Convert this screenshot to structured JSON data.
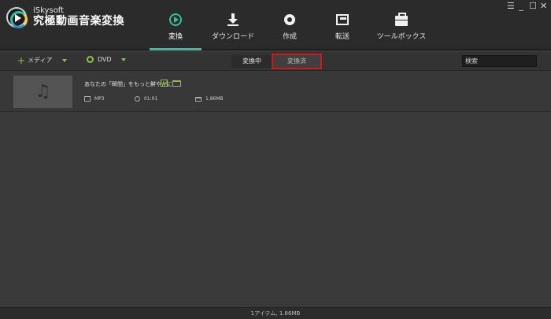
{
  "app": {
    "brand_sub": "iSkysoft",
    "brand_title": "究極動画音楽変換"
  },
  "nav": [
    {
      "label": "変換",
      "icon": "convert-icon",
      "active": true
    },
    {
      "label": "ダウンロード",
      "icon": "download-icon",
      "active": false
    },
    {
      "label": "作成",
      "icon": "burn-icon",
      "active": false
    },
    {
      "label": "転送",
      "icon": "transfer-icon",
      "active": false
    },
    {
      "label": "ツールボックス",
      "icon": "toolbox-icon",
      "active": false
    }
  ],
  "window_controls": {
    "menu": "☰",
    "minimize": "_",
    "maximize": "☐",
    "close": "✕"
  },
  "toolbar": {
    "add_media_label": "メディア",
    "dvd_label": "DVD",
    "tab_converting": "変換中",
    "tab_converted": "変換済",
    "search_placeholder": "検索"
  },
  "files": [
    {
      "name": "あなたの「瞬間」をもっと鮮やかに",
      "format": "MP3",
      "duration": "01:01",
      "size": "1.86MB"
    }
  ],
  "status": {
    "summary": "1アイテム, 1.86MB"
  },
  "colors": {
    "accent": "#2cc3a5",
    "green": "#8ac640",
    "highlight": "#d01818"
  }
}
